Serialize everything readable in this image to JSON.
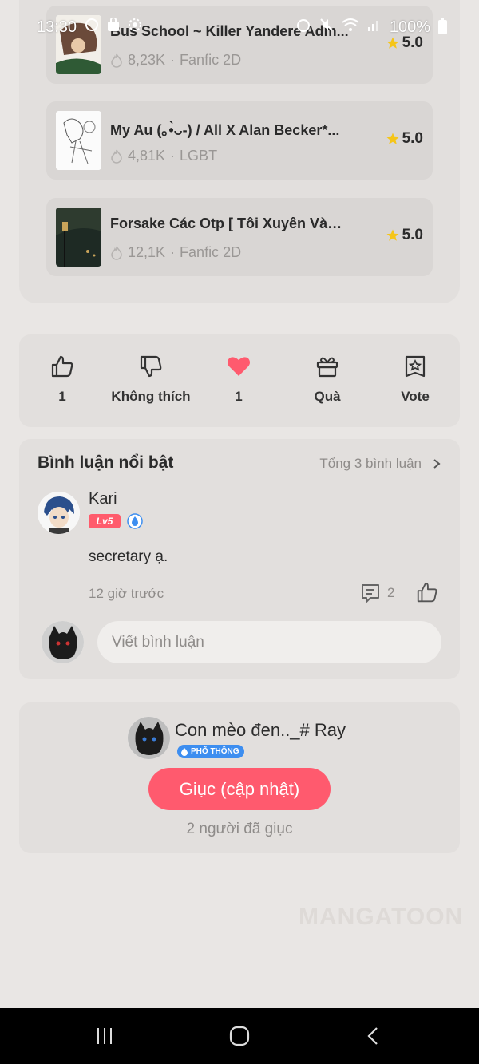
{
  "status_bar": {
    "time": "13:30",
    "battery": "100%"
  },
  "novels": [
    {
      "title": "Bus School ~ Killer Yandere Adm...",
      "views": "8,23K",
      "genre": "Fanfic 2D",
      "rating": "5.0"
    },
    {
      "title": "My Au (｡•̀ᴗ-) / All X Alan Becker*...",
      "views": "4,81K",
      "genre": "LGBT",
      "rating": "5.0"
    },
    {
      "title": "Forsake Các Otp [ Tôi Xuyên Vào ...",
      "views": "12,1K",
      "genre": "Fanfic 2D",
      "rating": "5.0"
    }
  ],
  "actions": {
    "like_count": "1",
    "dislike_label": "Không thích",
    "love_count": "1",
    "gift_label": "Quà",
    "vote_label": "Vote"
  },
  "comments": {
    "title": "Bình luận nổi bật",
    "total": "Tổng 3 bình luận",
    "items": [
      {
        "user": "Kari",
        "level": "Lv5",
        "text": "secretary ạ.",
        "time": "12 giờ trước",
        "replies": "2"
      }
    ],
    "input_placeholder": "Viết bình luận"
  },
  "author": {
    "name": "Con mèo đen.._# Ray",
    "tier": "PHỔ THÔNG",
    "urge_button": "Giục (cập nhật)",
    "urge_count": "2 người đã giục"
  },
  "watermark": "MANGATOON",
  "colors": {
    "accent": "#ff5a6e",
    "star": "#f5c518",
    "tier_blue": "#3d8ef0",
    "background": "#e9e6e4",
    "card": "#e2dfdd"
  }
}
